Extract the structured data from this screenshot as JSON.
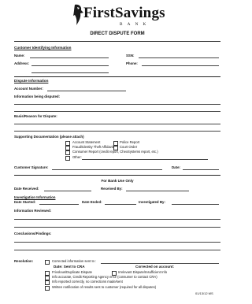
{
  "logo": {
    "name": "FirstSavings",
    "sub": "BANK"
  },
  "title": "DIRECT DISPUTE FORM",
  "customer": {
    "heading": "Customer Identifying Information",
    "name_label": "Name:",
    "ssn_label": "SSN:",
    "address_label": "Address:",
    "phone_label": "Phone:"
  },
  "dispute": {
    "heading": "Dispute Information",
    "account_label": "Account Number:",
    "info_label": "Information being disputed:",
    "basis_label": "Basis/Reason for Dispute:"
  },
  "supporting": {
    "heading": "Supporting Documentation (please attach)",
    "items_left": [
      "Account Statement",
      "Fraud/Identity Theft Affidavit",
      "Consumer Report (credit report, ChexSystems report, etc.)",
      "Other:"
    ],
    "items_right": [
      "Police Report",
      "Court Order"
    ]
  },
  "signature": {
    "sig_label": "Customer Signature:",
    "date_label": "Date:"
  },
  "bank_use": {
    "heading": "For Bank Use Only",
    "date_received_label": "Date Received:",
    "received_by_label": "Received By:",
    "investigation_heading": "Investigation Information",
    "date_started_label": "Date Started:",
    "date_ended_label": "Date Ended:",
    "investigated_by_label": "Investigated By:",
    "info_reviewed_label": "Information Reviewed:",
    "conclusions_label": "Conclusions/Findings:"
  },
  "resolution": {
    "label": "Resolution:",
    "corrected_sent": "Corrected information sent to :",
    "date_sent_cra": "Date: Sent to CRA",
    "corrected_on_acct": "Corrected on account:",
    "frivolous": "Frivolous/Duplicate Dispute",
    "irrelevant": "Irrelevant Dispute/Insufficient Info",
    "info_accurate": "Info accurate, Credit Reporting Agency error (consumer to contact CRA)",
    "info_reported": "Info reported correctly, no corrections made/sent",
    "written_notice": "Written notification of results sent to customer (required for all disputes)"
  },
  "footer": {
    "code": "01/13/12 MS"
  }
}
